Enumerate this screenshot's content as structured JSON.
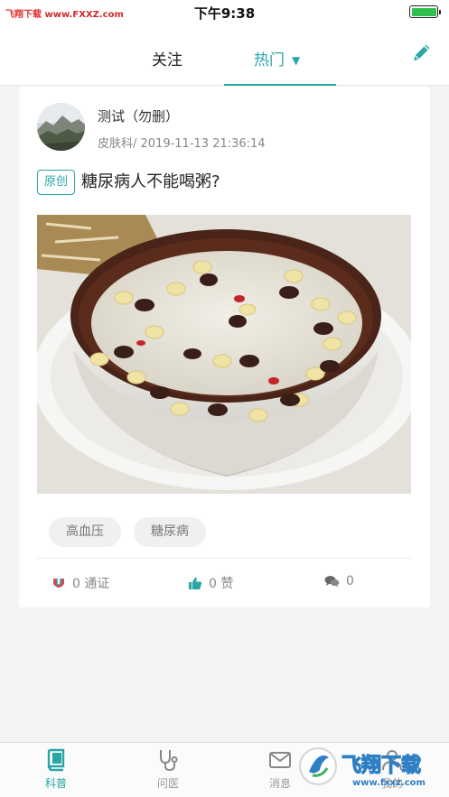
{
  "statusbar": {
    "carrier": "飞翔下载",
    "url": "www.FXXZ.com",
    "time": "下午9:38",
    "battery_level": 1.0
  },
  "nav": {
    "tab_follow": "关注",
    "tab_hot": "热门",
    "tab_hot_caret": "▼"
  },
  "post": {
    "author": "测试（勿删）",
    "meta": "皮肤科/ 2019-11-13 21:36:14",
    "badge": "原创",
    "title": "糖尿病人不能喝粥?",
    "tags": [
      "高血压",
      "糖尿病"
    ],
    "share_count": "0 通证",
    "like_count": "0 赞",
    "comment_count": "0"
  },
  "tabbar": {
    "items": [
      {
        "label": "科普",
        "icon": "book-icon",
        "active": true
      },
      {
        "label": "问医",
        "icon": "stethoscope-icon",
        "active": false
      },
      {
        "label": "消息",
        "icon": "mail-icon",
        "active": false
      },
      {
        "label": "我的",
        "icon": "user-icon",
        "active": false
      }
    ]
  },
  "watermark": {
    "text": "飞翔下载",
    "url": "www.fxxz.com"
  },
  "colors": {
    "accent": "#2aa6a6",
    "carrier_red": "#e0302e",
    "battery": "#2fbf4f"
  }
}
